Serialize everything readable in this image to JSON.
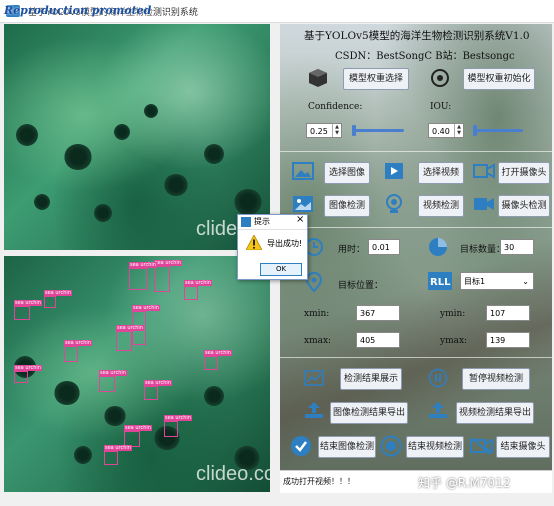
{
  "window": {
    "title": "基于YOLOv5模型的海洋生物检测识别系统"
  },
  "watermark": {
    "text": "Reproduction promoted"
  },
  "panes": {
    "top_watermark": "clideo.com",
    "bottom_watermark": "clideo.com",
    "detection_label": "sea urchin"
  },
  "header": {
    "title": "基于YOLOv5模型的海洋生物检测识别系统V1.0",
    "subtitle": "CSDN：BestSongC   B站：Bestsongc"
  },
  "model": {
    "select_label": "模型权重选择",
    "init_label": "模型权重初始化"
  },
  "params": {
    "confidence_label": "Confidence:",
    "confidence_value": "0.25",
    "iou_label": "IOU:",
    "iou_value": "0.40"
  },
  "buttons": {
    "select_image": "选择图像",
    "select_video": "选择视频",
    "open_camera": "打开摄像头",
    "image_detect": "图像检测",
    "video_detect": "视频检测",
    "camera_detect": "摄像头检测",
    "show_results": "检测结果展示",
    "pause_video": "暂停视频检测",
    "export_image": "图像检测结果导出",
    "export_video": "视频检测结果导出",
    "end_image": "结束图像检测",
    "end_video": "结束视频检测",
    "end_camera": "结束摄像头"
  },
  "stats": {
    "time_label": "用时：",
    "time_value": "0.01",
    "count_label": "目标数量：",
    "count_value": "30",
    "position_label": "目标位置：",
    "target_select": "目标1",
    "xmin_label": "xmin:",
    "xmin_value": "367",
    "ymin_label": "ymin:",
    "ymin_value": "107",
    "xmax_label": "xmax:",
    "xmax_value": "405",
    "ymax_label": "ymax:",
    "ymax_value": "139"
  },
  "dialog": {
    "title": "提示",
    "message": "导出成功!",
    "ok": "OK",
    "close": "×"
  },
  "status": {
    "text": "成功打开视频！！！"
  },
  "footer_watermark": "知乎 @R.M7012",
  "colors": {
    "accent": "#2d7fc1",
    "box": "#e0459a",
    "button_border": "#8f9bb0"
  },
  "icons": [
    "cube-icon",
    "target-icon",
    "image-icon",
    "video-icon",
    "camera-icon",
    "image-detect-icon",
    "video-detect-icon",
    "camera-detect-icon",
    "clock-icon",
    "pie-chart-icon",
    "location-icon",
    "rll-icon",
    "chart-icon",
    "pause-icon",
    "upload-icon",
    "check-icon",
    "stop-icon",
    "camera-off-icon",
    "warning-icon"
  ]
}
